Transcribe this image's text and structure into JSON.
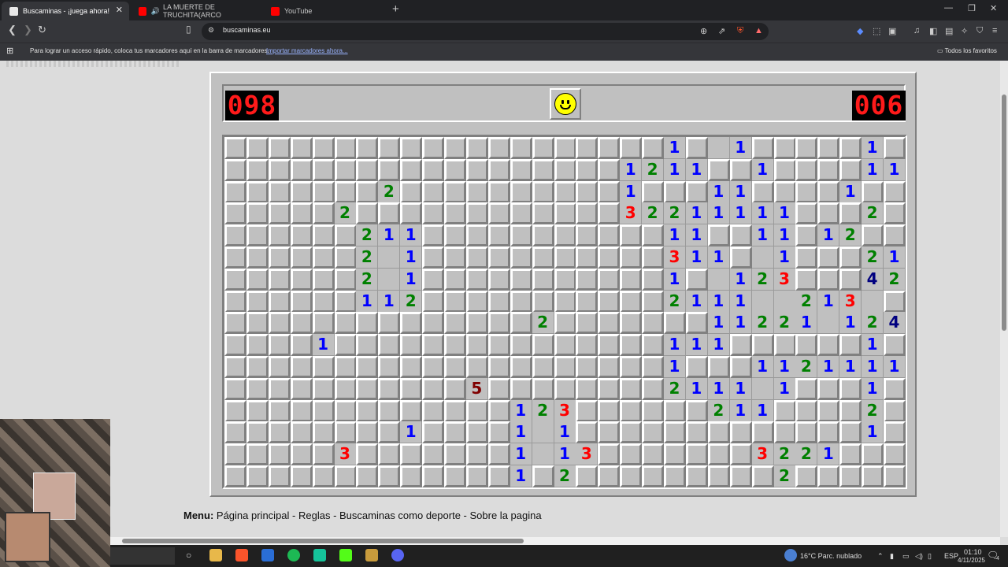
{
  "browser": {
    "tabs": [
      {
        "title": "Buscaminas - ¡juega ahora!",
        "active": true,
        "favicon_color": "#e8e8e8"
      },
      {
        "title": "LA MUERTE DE TRUCHITA(ARCO",
        "active": false,
        "favicon_color": "#ff0000",
        "audio": "🔊"
      },
      {
        "title": "YouTube",
        "active": false,
        "favicon_color": "#ff0000"
      }
    ],
    "url": "buscaminas.eu",
    "bookmarks_message": "Para lograr un acceso rápido, coloca tus marcadores aquí en la barra de marcadores.",
    "bookmarks_import": "Importar marcadores ahora...",
    "all_favorites": "Todos los favoritos"
  },
  "game": {
    "mines_counter": "098",
    "timer": "006",
    "board": {
      "cols": 31,
      "rows": 16,
      "revealed_rows": [
        "..........................1..1......1",
        "...........................1211..1......11",
        "................2...........1...11.....1",
        "..............2...........32211111......2"
      ]
    }
  },
  "menu": {
    "label": "Menu:",
    "items": [
      "Página principal",
      "Reglas",
      "Buscaminas como deporte",
      "Sobre la pagina"
    ]
  },
  "taskbar": {
    "weather": "16°C  Parc. nublado",
    "lang": "ESP",
    "time": "01:10",
    "date": "4/11/2025",
    "notifications": "4"
  }
}
